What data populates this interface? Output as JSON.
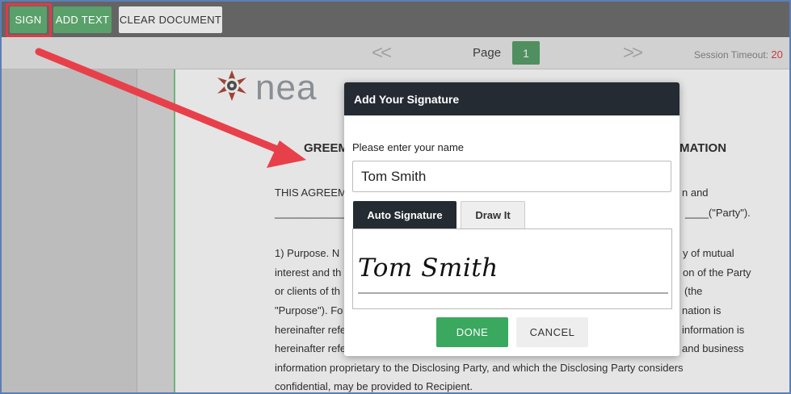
{
  "toolbar": {
    "sign_label": "SIGN",
    "add_text_label": "ADD TEXT",
    "clear_label": "CLEAR DOCUMENT"
  },
  "nav": {
    "prev": "<<",
    "next": ">>",
    "page_label": "Page",
    "page_number": "1",
    "timeout_label": "Session Timeout:",
    "timeout_value": "20"
  },
  "document": {
    "logo_text": "nea",
    "heading_left": "GREEM",
    "heading_right": "MATION",
    "lines": [
      {
        "left": "THIS AGREEM",
        "right": "n and"
      },
      {
        "left": "________________",
        "right": "____(\"Party\")."
      },
      {
        "left": "1) Purpose.  N",
        "right": "y of mutual"
      },
      {
        "left": "interest and th",
        "right": "on of the Party"
      },
      {
        "left": "or clients of th",
        "right": "(the"
      },
      {
        "left": "\"Purpose\").  Fo",
        "right": "nation is"
      },
      {
        "left": "hereinafter refe",
        "right": "information is"
      },
      {
        "left": "hereinafter refe",
        "right": "and business"
      },
      {
        "left": "information proprietary to the Disclosing Party, and which the Disclosing Party considers",
        "right": ""
      },
      {
        "left": "confidential, may be provided to Recipient.",
        "right": ""
      }
    ]
  },
  "modal": {
    "title": "Add Your Signature",
    "name_label": "Please enter your name",
    "name_value": "Tom Smith",
    "tabs": [
      "Auto Signature",
      "Draw It"
    ],
    "signature_preview": "Tom Smith",
    "done_label": "DONE",
    "cancel_label": "CANCEL"
  },
  "colors": {
    "accent_green": "#5aa06a",
    "done_green": "#3aa85e",
    "header_dark": "#252b33",
    "highlight_red": "#e03a45"
  }
}
